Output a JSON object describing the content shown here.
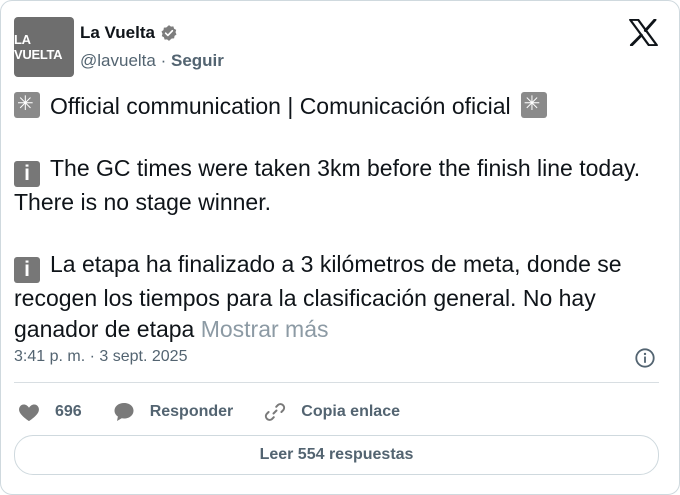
{
  "author": {
    "avatar_text": "LA VUELTA",
    "name": "La Vuelta",
    "handle": "@lavuelta",
    "separator": "·",
    "follow_label": "Seguir"
  },
  "tweet": {
    "line1": "Official communication | Comunicación oficial",
    "line2": "The GC times were taken 3km before the finish line today. There is no stage winner.",
    "line3": "La etapa ha finalizado a 3 kilómetros de meta, donde se recogen los tiempos para la clasificación general. No hay ganador de etapa",
    "show_more": "Mostrar más",
    "emoji_info": "i"
  },
  "meta": {
    "time": "3:41 p. m.",
    "separator": "·",
    "date": "3 sept. 2025"
  },
  "actions": {
    "likes": "696",
    "reply_label": "Responder",
    "copy_label": "Copia enlace"
  },
  "read_replies_label": "Leer 554 respuestas",
  "icons": {
    "verified": "verified-badge-icon",
    "x_logo": "x-logo-icon",
    "siren": "rotating-light-emoji",
    "info_emoji": "information-emoji",
    "info": "info-circle-icon",
    "heart": "heart-icon",
    "reply": "speech-bubble-icon",
    "link": "link-icon"
  }
}
